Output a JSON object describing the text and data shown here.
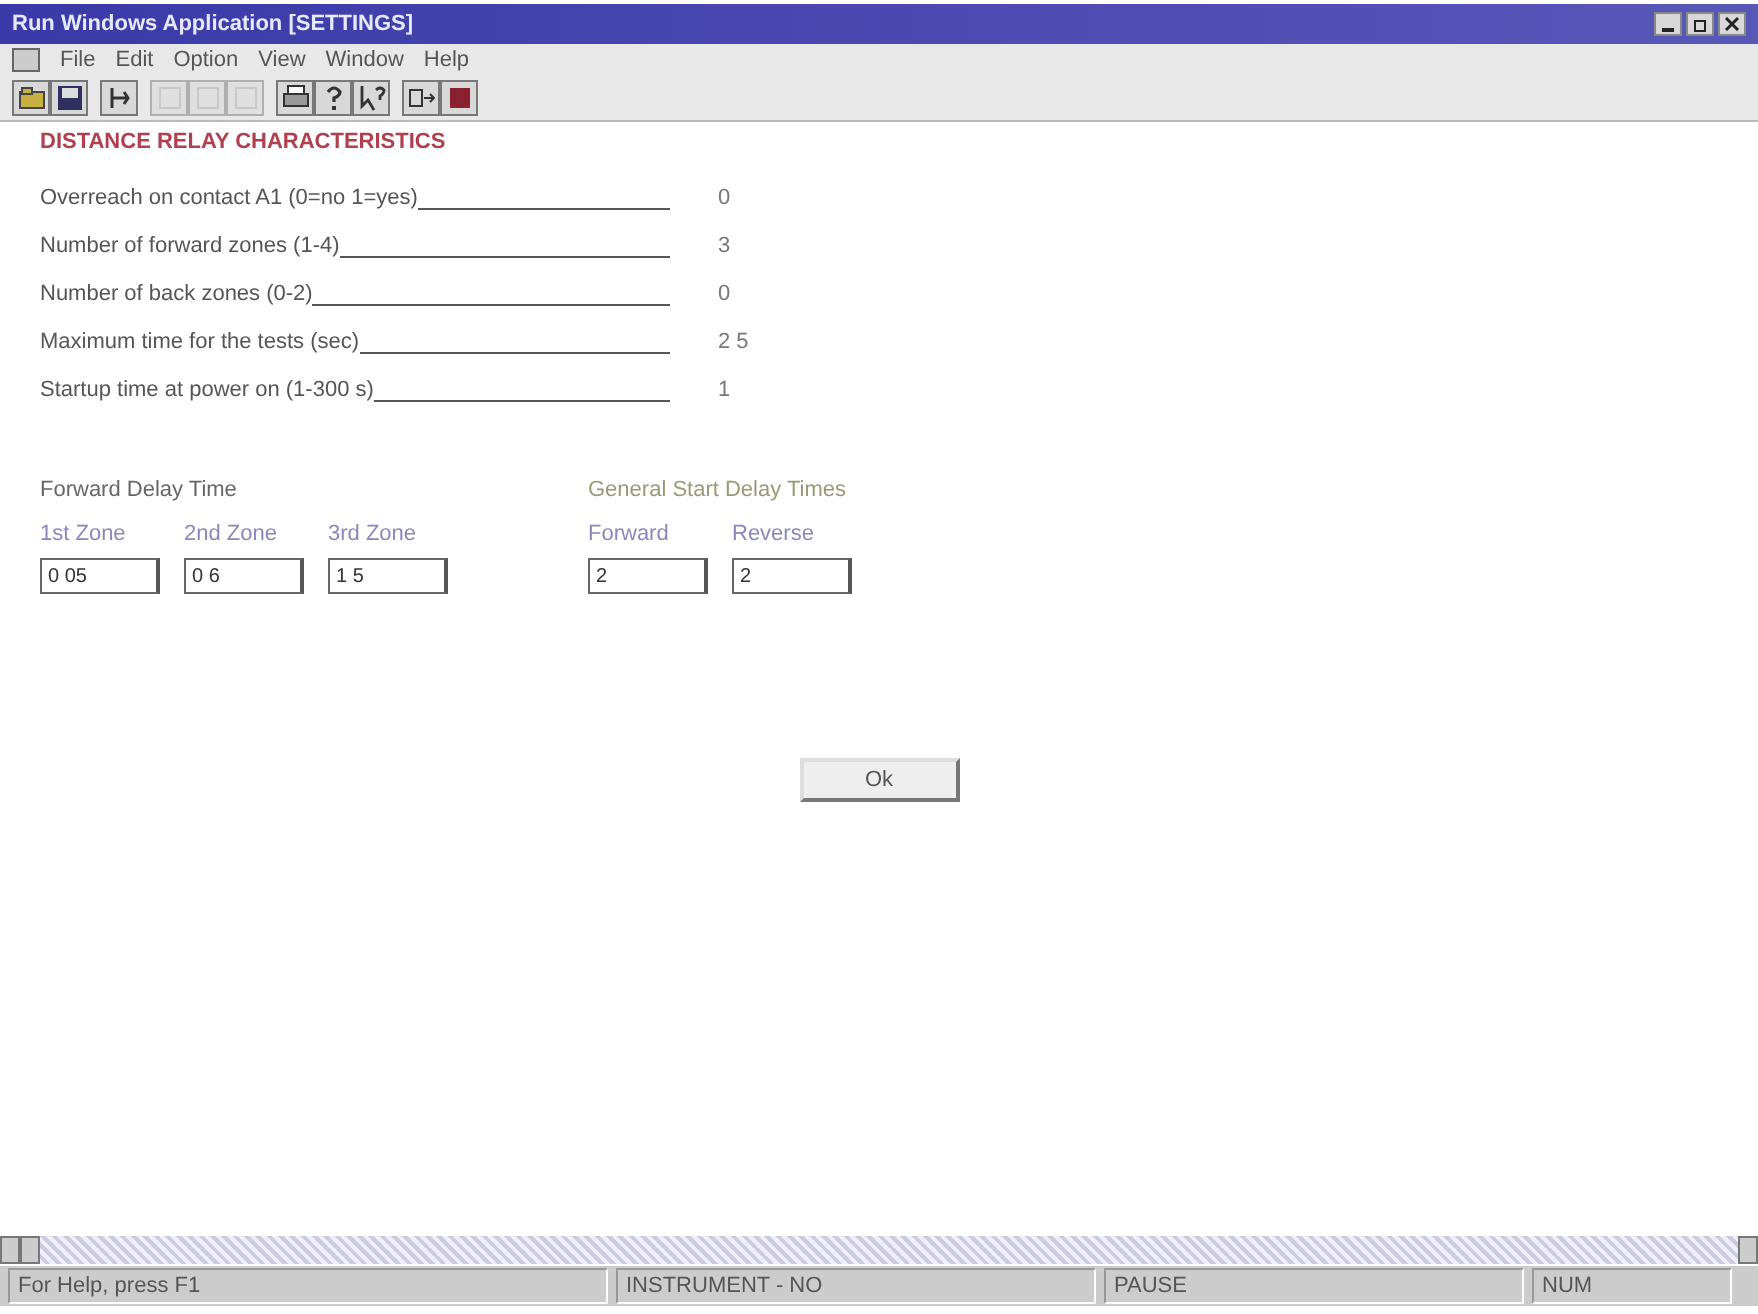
{
  "window": {
    "title": "Run Windows Application  [SETTINGS]"
  },
  "menu": [
    "File",
    "Edit",
    "Option",
    "View",
    "Window",
    "Help"
  ],
  "toolbar": [
    {
      "kind": "open",
      "disabled": false
    },
    {
      "kind": "save",
      "disabled": false
    },
    {
      "kind": "tool",
      "disabled": false
    },
    {
      "kind": "blank",
      "disabled": true
    },
    {
      "kind": "blank",
      "disabled": true
    },
    {
      "kind": "blank",
      "disabled": true
    },
    {
      "kind": "print",
      "disabled": false
    },
    {
      "kind": "help",
      "disabled": false
    },
    {
      "kind": "context-help",
      "disabled": false
    },
    {
      "kind": "run",
      "disabled": false
    },
    {
      "kind": "stop",
      "disabled": false
    }
  ],
  "heading": "DISTANCE RELAY CHARACTERISTICS",
  "settings": [
    {
      "label": "Overreach on contact A1   (0=no 1=yes)",
      "value": "0"
    },
    {
      "label": "Number of forward zones (1-4)",
      "value": "3"
    },
    {
      "label": "Number of back zones (0-2)",
      "value": "0"
    },
    {
      "label": "Maximum time for the tests (sec)",
      "value": "2 5"
    },
    {
      "label": "Startup time at power on (1-300 s)",
      "value": "1"
    }
  ],
  "groups": [
    {
      "title": "Forward Delay Time",
      "fields": [
        {
          "label": "1st Zone",
          "value": "0 05"
        },
        {
          "label": "2nd Zone",
          "value": "0 6"
        },
        {
          "label": "3rd Zone",
          "value": "1 5"
        }
      ]
    },
    {
      "title": "General Start Delay Times",
      "fields": [
        {
          "label": "Forward",
          "value": "2"
        },
        {
          "label": "Reverse",
          "value": "2"
        }
      ]
    }
  ],
  "ok_button": "Ok",
  "status_bar": [
    "For Help, press F1",
    "INSTRUMENT - NO",
    "PAUSE",
    "NUM"
  ]
}
